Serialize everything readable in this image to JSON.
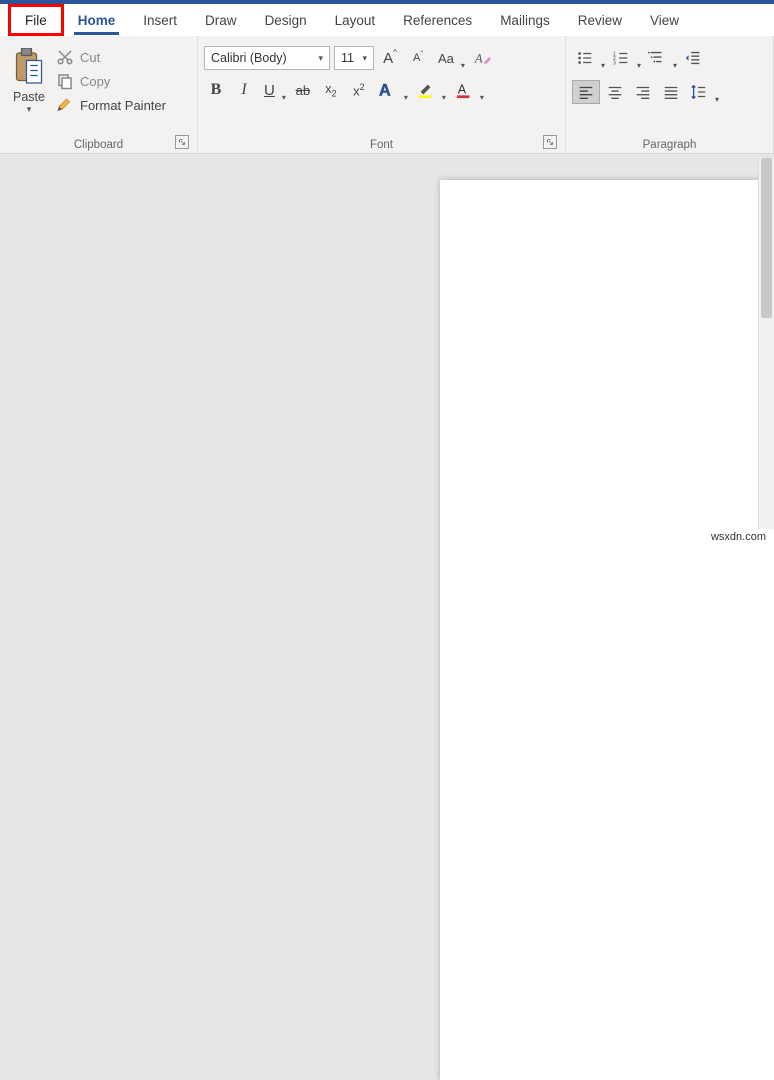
{
  "tabs": {
    "file": "File",
    "home": "Home",
    "insert": "Insert",
    "draw": "Draw",
    "design": "Design",
    "layout": "Layout",
    "references": "References",
    "mailings": "Mailings",
    "review": "Review",
    "view": "View"
  },
  "clipboard": {
    "paste": "Paste",
    "cut": "Cut",
    "copy": "Copy",
    "format_painter": "Format Painter",
    "label": "Clipboard"
  },
  "font": {
    "name": "Calibri (Body)",
    "size": "11",
    "change_case": "Aa",
    "grow": "A",
    "shrink": "A",
    "label": "Font"
  },
  "paragraph": {
    "label": "Paragraph"
  },
  "watermark": "wsxdn.com"
}
